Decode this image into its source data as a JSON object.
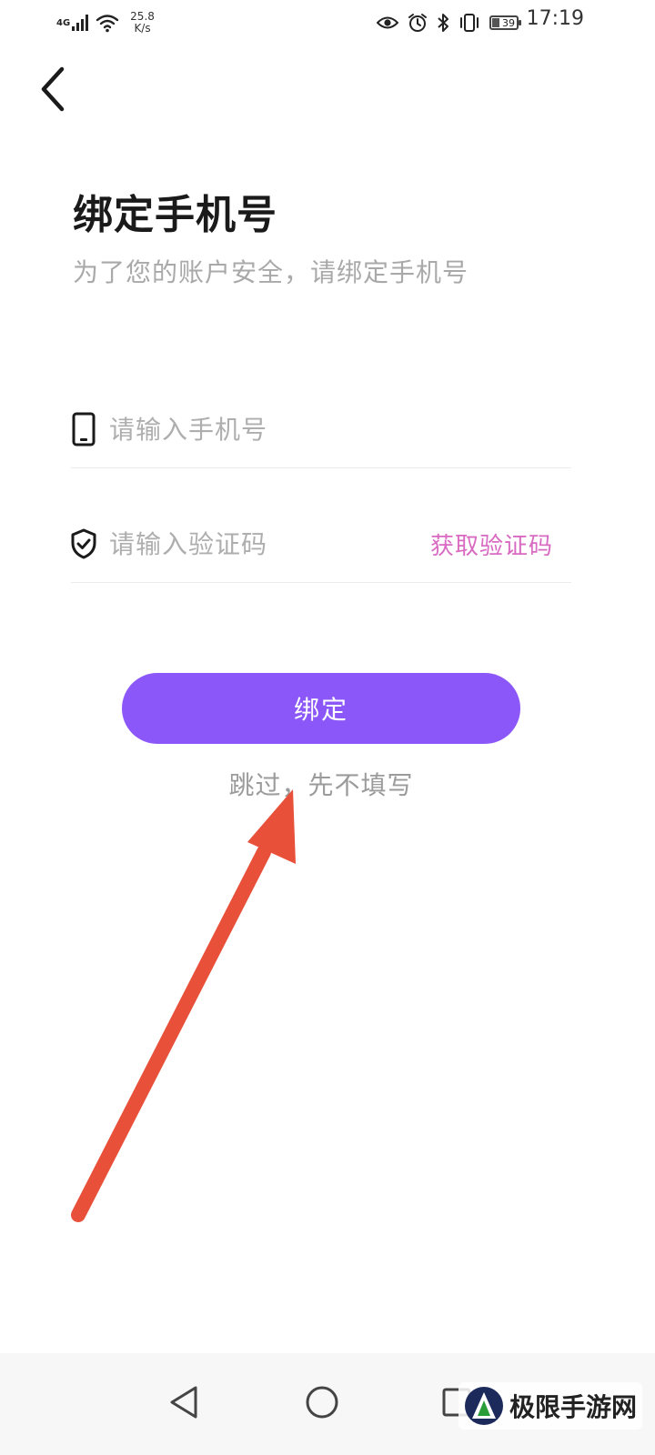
{
  "status_bar": {
    "network": "4G",
    "speed_value": "25.8",
    "speed_unit": "K/s",
    "battery": "39",
    "time": "17:19",
    "icons": [
      "signal-icon",
      "wifi-icon",
      "eye-icon",
      "alarm-icon",
      "bluetooth-icon",
      "vibrate-icon",
      "battery-icon"
    ]
  },
  "header": {
    "back_icon": "chevron-left-icon"
  },
  "page": {
    "title": "绑定手机号",
    "subtitle": "为了您的账户安全，请绑定手机号"
  },
  "form": {
    "phone": {
      "icon": "phone-icon",
      "placeholder": "请输入手机号",
      "value": ""
    },
    "code": {
      "icon": "shield-check-icon",
      "placeholder": "请输入验证码",
      "value": "",
      "get_code_label": "获取验证码"
    },
    "submit_label": "绑定",
    "skip_label": "跳过，先不填写"
  },
  "colors": {
    "accent": "#8c57f8",
    "link": "#d96ac2",
    "annotation_arrow": "#e8503a"
  },
  "annotation": {
    "icon": "red-arrow-pointer"
  },
  "nav_bar": {
    "icons": [
      "back-triangle-icon",
      "home-circle-icon",
      "recents-square-icon"
    ]
  },
  "watermark": {
    "text": "极限手游网"
  }
}
